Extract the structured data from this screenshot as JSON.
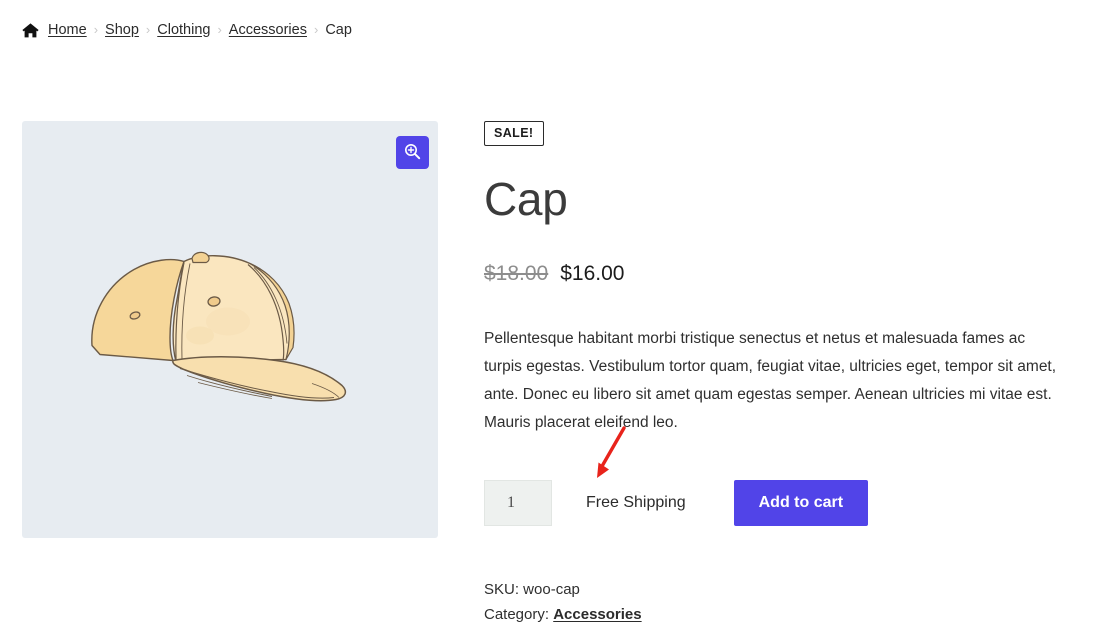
{
  "breadcrumb": {
    "home_icon": "home-icon",
    "separator": "›",
    "items": [
      {
        "label": "Home",
        "link": true
      },
      {
        "label": "Shop",
        "link": true
      },
      {
        "label": "Clothing",
        "link": true
      },
      {
        "label": "Accessories",
        "link": true
      },
      {
        "label": "Cap",
        "link": false
      }
    ]
  },
  "gallery": {
    "image_alt": "Cap",
    "background_color": "#e7ecf1",
    "zoom_button": {
      "icon": "magnifier-plus-icon",
      "color": "#5144e8"
    }
  },
  "summary": {
    "sale_badge": "SALE!",
    "title": "Cap",
    "price": {
      "old": "$18.00",
      "new": "$16.00"
    },
    "description": "Pellentesque habitant morbi tristique senectus et netus et malesuada fames ac turpis egestas. Vestibulum tortor quam, feugiat vitae, ultricies eget, tempor sit amet, ante. Donec eu libero sit amet quam egestas semper. Aenean ultricies mi vitae est. Mauris placerat eleifend leo.",
    "cart": {
      "quantity_value": "1",
      "quantity_placeholder": "1",
      "free_shipping_label": "Free Shipping",
      "add_to_cart_label": "Add to cart",
      "button_color": "#5144e8"
    },
    "meta": {
      "sku_line": "SKU: woo-cap",
      "category_prefix": "Category:",
      "category_link": "Accessories"
    }
  },
  "annotation": {
    "type": "arrow",
    "color": "#e8231b",
    "points_to": "free-shipping-label"
  }
}
